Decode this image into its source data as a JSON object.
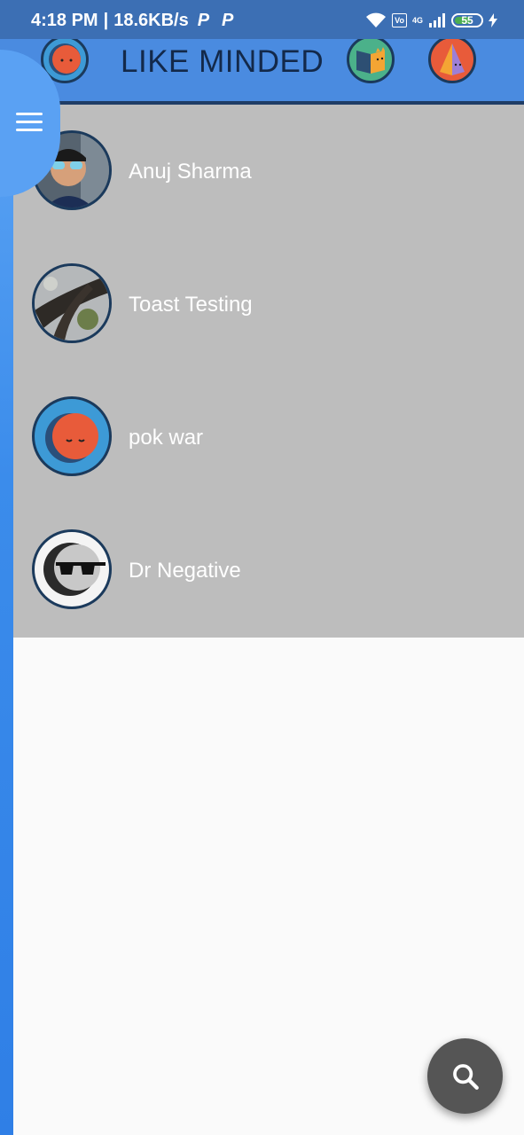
{
  "status_bar": {
    "time": "4:18 PM",
    "speed": "18.6KB/s",
    "network_small": "4G",
    "battery": "55"
  },
  "header": {
    "title": "LIKE MINDED"
  },
  "users": [
    {
      "name": "Anuj Sharma",
      "avatar": "photo-avatar"
    },
    {
      "name": "Toast Testing",
      "avatar": "tree-photo-avatar"
    },
    {
      "name": "pok war",
      "avatar": "red-moon-avatar"
    },
    {
      "name": "Dr Negative",
      "avatar": "sunglasses-moon-avatar"
    }
  ],
  "colors": {
    "status_bar": "#3c6fb4",
    "header": "#4a8be0",
    "list_bg": "#bdbdbd",
    "page_bg": "#fafafa",
    "fab": "#555555"
  }
}
